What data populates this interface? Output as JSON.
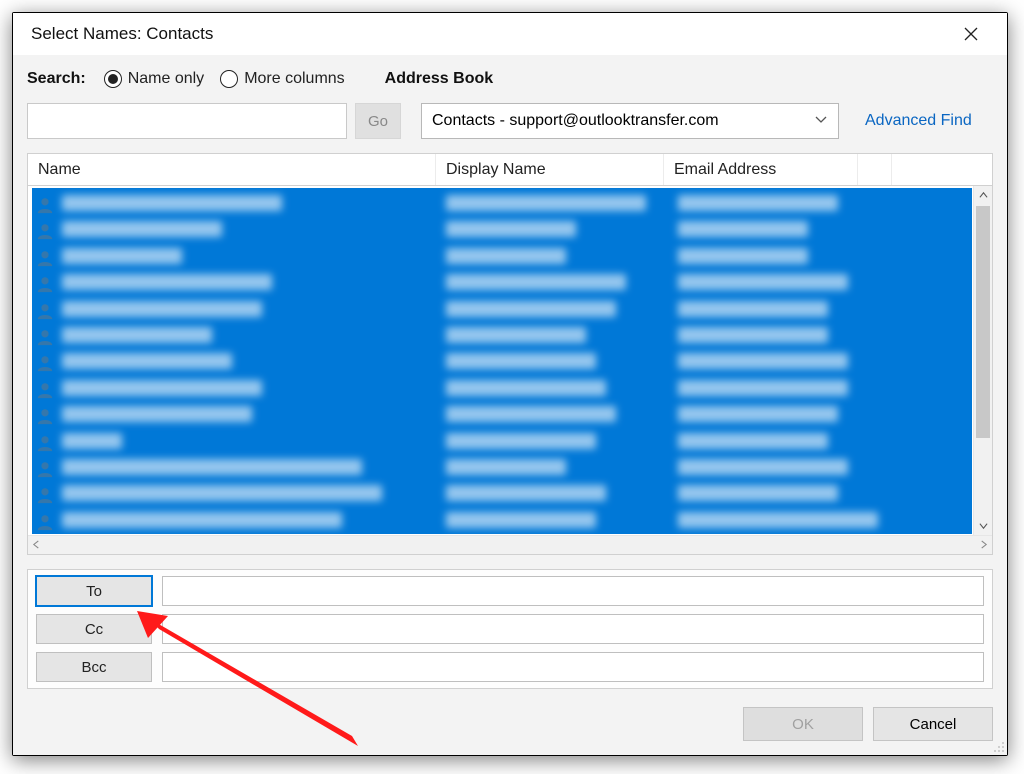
{
  "window": {
    "title": "Select Names: Contacts"
  },
  "search": {
    "label": "Search:",
    "radio_name_only": "Name only",
    "radio_more_columns": "More columns",
    "selected_radio": "name_only",
    "input_value": "",
    "go_label": "Go"
  },
  "address_book": {
    "label": "Address Book",
    "selected": "Contacts - support@outlooktransfer.com",
    "advanced_find": "Advanced Find"
  },
  "columns": {
    "name": "Name",
    "display": "Display Name",
    "email": "Email Address"
  },
  "recipients": {
    "to_label": "To",
    "cc_label": "Cc",
    "bcc_label": "Bcc",
    "to_value": "",
    "cc_value": "",
    "bcc_value": ""
  },
  "actions": {
    "ok": "OK",
    "cancel": "Cancel"
  },
  "contact_rows": 13,
  "colors": {
    "selection": "#0078d7",
    "link": "#0a66c2",
    "annotation": "#ff1a1a"
  }
}
